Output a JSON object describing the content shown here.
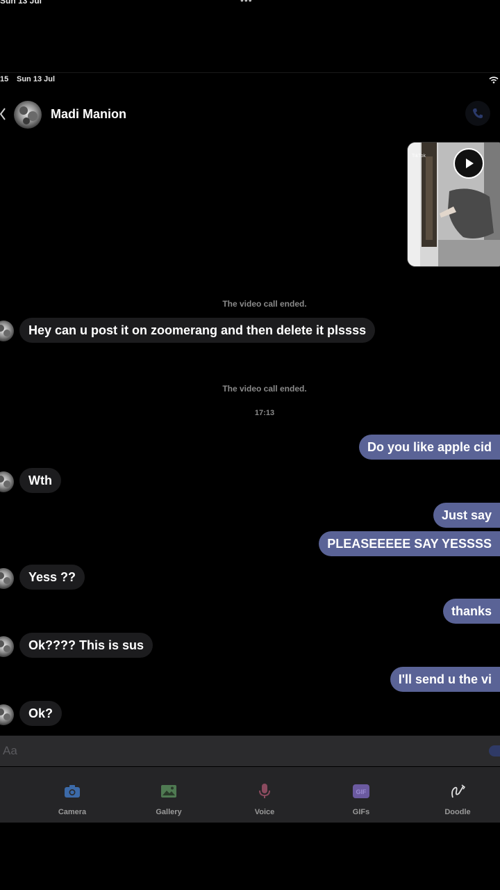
{
  "top_status": {
    "text": "Sun 13 Jul",
    "dots": "•••"
  },
  "status_bar": {
    "time": "15",
    "date": "Sun 13 Jul"
  },
  "header": {
    "contact_name": "Madi Manion"
  },
  "media": {
    "watermark": "TikTok"
  },
  "messages": [
    {
      "type": "system",
      "text": "The video call ended."
    },
    {
      "type": "incoming",
      "text": "Hey can u post it on zoomerang and then delete it plssss"
    },
    {
      "type": "system",
      "text": "The video call ended."
    },
    {
      "type": "timestamp",
      "text": "17:13"
    },
    {
      "type": "outgoing",
      "text": "Do you like apple cid"
    },
    {
      "type": "incoming",
      "text": "Wth"
    },
    {
      "type": "outgoing",
      "text": "Just say"
    },
    {
      "type": "outgoing",
      "text": "PLEASEEEEE SAY YESSSS"
    },
    {
      "type": "incoming",
      "text": "Yess ??"
    },
    {
      "type": "outgoing",
      "text": "thanks"
    },
    {
      "type": "incoming",
      "text": "Ok???? This is sus"
    },
    {
      "type": "outgoing",
      "text": "I'll send u the vi"
    },
    {
      "type": "incoming",
      "text": "Ok?"
    }
  ],
  "composer": {
    "placeholder": "Aa"
  },
  "toolbar": {
    "items": [
      {
        "label": "Camera",
        "icon": "camera-icon",
        "color": "#3c6aa8"
      },
      {
        "label": "Gallery",
        "icon": "gallery-icon",
        "color": "#4f7a52"
      },
      {
        "label": "Voice",
        "icon": "microphone-icon",
        "color": "#8a4a5e"
      },
      {
        "label": "GIFs",
        "icon": "gif-icon",
        "color": "#6b5aa0"
      },
      {
        "label": "Doodle",
        "icon": "doodle-icon",
        "color": "#e0e0e0"
      }
    ]
  },
  "colors": {
    "outgoing_bubble": "#5a6396",
    "incoming_bubble": "#1c1c1e",
    "background": "#000000"
  }
}
